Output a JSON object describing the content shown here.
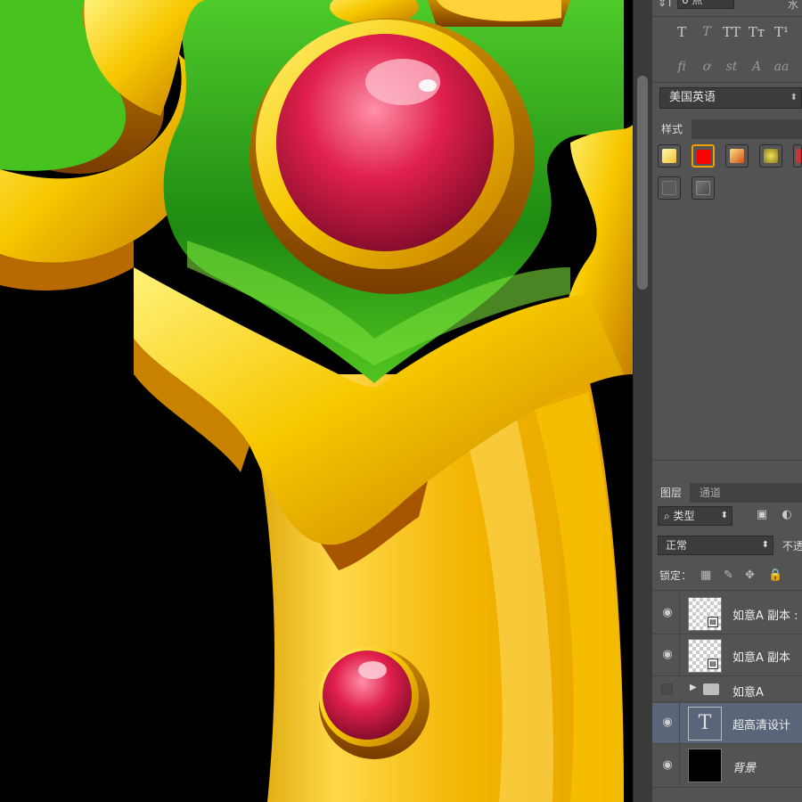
{
  "char_panel": {
    "size_icon": "font-size-icon",
    "size_value": "6 点",
    "scaling_label": "水",
    "type_buttons": [
      "T",
      "T",
      "TT",
      "Tт",
      "T¹"
    ],
    "opentype_buttons": [
      "ﬁ",
      "ơ",
      "st",
      "A",
      "aa"
    ],
    "language": "美国英语"
  },
  "styles_panel": {
    "tab_label": "样式",
    "swatch_colors": [
      "#f4e25c",
      "#ff0000",
      "#e0781e",
      "#e8d24a",
      "#cc3333",
      "#6a6a6a",
      "#6a6a6a"
    ]
  },
  "layers_panel": {
    "tabs": [
      "图层",
      "通道"
    ],
    "filter_label": "⌕ 类型",
    "blend_mode": "正常",
    "opacity_label": "不透",
    "lock_label": "锁定：",
    "layers": [
      {
        "name": "如意A 副本 :",
        "type": "smart"
      },
      {
        "name": "如意A 副本",
        "type": "smart"
      },
      {
        "name": "如意A",
        "type": "group"
      },
      {
        "name": "超高清设计",
        "type": "text",
        "selected": true
      },
      {
        "name": "背景",
        "type": "background"
      }
    ]
  },
  "colors": {
    "panel_bg": "#535353",
    "canvas_bg": "#000000",
    "selected_layer": "#5a6579",
    "gold": "#f5c400",
    "jade_green": "#3fbf1f",
    "ruby": "#d8204a"
  }
}
